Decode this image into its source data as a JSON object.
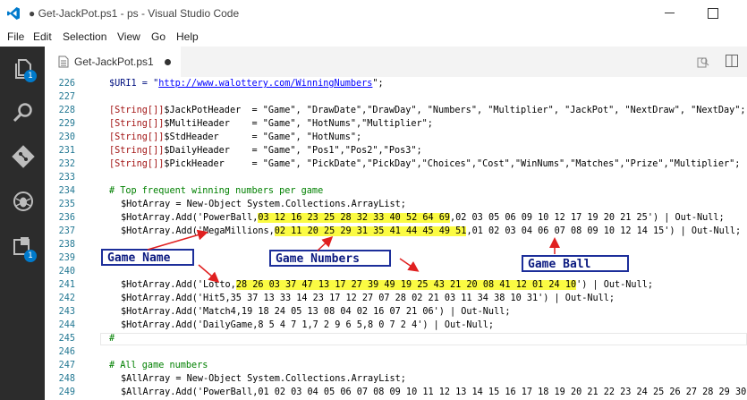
{
  "window": {
    "title": "● Get-JackPot.ps1 - ps - Visual Studio Code"
  },
  "menu": [
    "File",
    "Edit",
    "Selection",
    "View",
    "Go",
    "Help"
  ],
  "activity_bar": {
    "icons": [
      "files-icon",
      "search-icon",
      "source-control-icon",
      "debug-icon",
      "extensions-icon"
    ],
    "explorer_badge": "1",
    "extensions_badge": "1"
  },
  "tab": {
    "label": "Get-JackPot.ps1"
  },
  "line_numbers": [
    "226",
    "227",
    "228",
    "229",
    "230",
    "231",
    "232",
    "233",
    "234",
    "235",
    "236",
    "237",
    "238",
    "239",
    "240",
    "241",
    "242",
    "243",
    "244",
    "245",
    "246",
    "247",
    "248",
    "249"
  ],
  "code": {
    "l226": "$URI1 = \"http://www.walottery.com/WinningNumbers\";",
    "l226_prefix": "$URI1 = \"",
    "l226_url": "http://www.walottery.com/WinningNumbers",
    "l226_suffix": "\";",
    "l228_type": "[String[]]",
    "l228_rest": "$JackPotHeader  = \"Game\", \"DrawDate\",\"DrawDay\", \"Numbers\", \"Multiplier\", \"JackPot\", \"NextDraw\", \"NextDay\";",
    "l229_type": "[String[]]",
    "l229_rest": "$MultiHeader    = \"Game\", \"HotNums\",\"Multiplier\";",
    "l230_type": "[String[]]",
    "l230_rest": "$StdHeader      = \"Game\", \"HotNums\";",
    "l231_type": "[String[]]",
    "l231_rest": "$DailyHeader    = \"Game\", \"Pos1\",\"Pos2\",\"Pos3\";",
    "l232_type": "[String[]]",
    "l232_rest": "$PickHeader     = \"Game\", \"PickDate\",\"PickDay\",\"Choices\",\"Cost\",\"WinNums\",\"Matches\",\"Prize\",\"Multiplier\";",
    "l234": "# Top frequent winning numbers per game",
    "l235": "$HotArray = New-Object System.Collections.ArrayList;",
    "l236_a": "$HotArray.Add('PowerBall,",
    "l236_hl": "03 12 16 23 25 28 32 33 40 52 64 69",
    "l236_b": ",02 03 05 06 09 10 12 17 19 20 21 25') | Out-Null;",
    "l237_a": "$HotArray.Add('",
    "l237_name": "MegaMillions",
    "l237_c": ",",
    "l237_hl": "02 11 20 25 29 31 35 41 44 45 49 51",
    "l237_b": ",01 02 03 04 06 07 ",
    "l237_ball": "08",
    "l237_d": " 09 10 12 14 15') | Out-Null;",
    "l241_a": "$HotArray.Add('Lotto,",
    "l241_hl": "28 26 03 37 47 13 17 27 39 49 19 25 43 21 20 08 41 12 01 24 10",
    "l241_b": "') | Out-Null;",
    "l242": "$HotArray.Add('Hit5,35 37 13 33 14 23 17 12 27 07 28 02 21 03 11 34 38 10 31') | Out-Null;",
    "l243": "$HotArray.Add('Match4,19 18 24 05 13 08 04 02 16 07 21 06') | Out-Null;",
    "l244": "$HotArray.Add('DailyGame,8 5 4 7 1,7 2 9 6 5,8 0 7 2 4') | Out-Null;",
    "l245": "#",
    "l247": "# All game numbers",
    "l248": "$AllArray = New-Object System.Collections.ArrayList;",
    "l249": "$AllArray.Add('PowerBall,01 02 03 04 05 06 07 08 09 10 11 12 13 14 15 16 17 18 19 20 21 22 23 24 25 26 27 28 29 30 3"
  },
  "annotations": {
    "game_name": "Game Name",
    "game_numbers": "Game Numbers",
    "game_ball": "Game Ball",
    "arrow_color": "#e02020",
    "box_border_color": "#1c2e9a",
    "highlight_color": "#fbfb43"
  }
}
